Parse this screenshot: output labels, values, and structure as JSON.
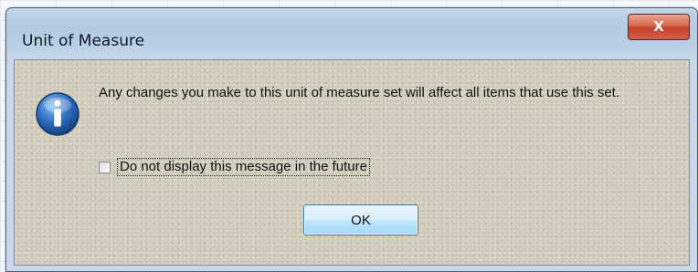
{
  "dialog": {
    "title": "Unit of Measure",
    "close_glyph": "X",
    "icon": "information-icon",
    "message": "Any changes you make to this unit of measure set will affect all items that use this set.",
    "checkbox": {
      "label": "Do not display this message in the future",
      "checked": false
    },
    "ok_label": "OK"
  },
  "colors": {
    "titlebar": "#b9cfe5",
    "close_button": "#c5402a",
    "client_background": "#cfcab8",
    "info_icon": "#2f6fc0",
    "ok_button_border": "#3c7fb1"
  }
}
